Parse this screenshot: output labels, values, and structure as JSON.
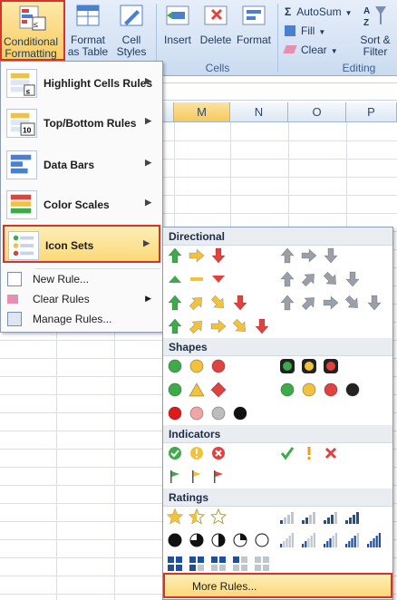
{
  "ribbon": {
    "conditional_formatting": "Conditional Formatting",
    "format_as_table": "Format as Table",
    "cell_styles": "Cell Styles",
    "insert": "Insert",
    "delete": "Delete",
    "format": "Format",
    "cells_group": "Cells",
    "autosum": "AutoSum",
    "fill": "Fill",
    "clear": "Clear",
    "sort_filter": "Sort & Filter",
    "editing_group": "Editing"
  },
  "columns": [
    "M",
    "N",
    "O",
    "P"
  ],
  "menu": {
    "items": [
      "Highlight Cells Rules",
      "Top/Bottom Rules",
      "Data Bars",
      "Color Scales",
      "Icon Sets"
    ],
    "small": [
      "New Rule...",
      "Clear Rules",
      "Manage Rules..."
    ]
  },
  "submenu": {
    "sections": [
      "Directional",
      "Shapes",
      "Indicators",
      "Ratings"
    ],
    "more": "More Rules..."
  },
  "colors": {
    "highlight_border": "#d9312b",
    "green": "#3dab4a",
    "yellow": "#f3c23d",
    "red": "#e0423f",
    "gray": "#9aa0a7"
  }
}
